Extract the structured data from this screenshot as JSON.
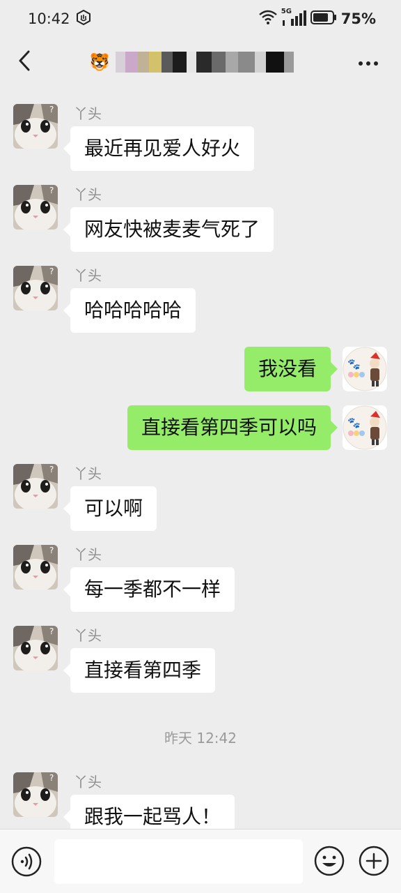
{
  "status_bar": {
    "time": "10:42",
    "network": "5G",
    "battery_percent": "75%"
  },
  "nav": {
    "title_emoji": "🐯"
  },
  "messages": [
    {
      "side": "left",
      "sender": "丫头",
      "text": "最近再见爱人好火"
    },
    {
      "side": "left",
      "sender": "丫头",
      "text": "网友快被麦麦气死了"
    },
    {
      "side": "left",
      "sender": "丫头",
      "text": "哈哈哈哈哈"
    },
    {
      "side": "right",
      "text": "我没看"
    },
    {
      "side": "right",
      "text": "直接看第四季可以吗"
    },
    {
      "side": "left",
      "sender": "丫头",
      "text": "可以啊"
    },
    {
      "side": "left",
      "sender": "丫头",
      "text": "每一季都不一样"
    },
    {
      "side": "left",
      "sender": "丫头",
      "text": "直接看第四季"
    },
    {
      "side": "left",
      "sender": "丫头",
      "text": "跟我一起骂人！"
    }
  ],
  "time_separator": "昨天 12:42",
  "input": {
    "value": "",
    "placeholder": ""
  },
  "colors": {
    "background": "#ededed",
    "incoming_bubble": "#ffffff",
    "outgoing_bubble": "#95ec69",
    "muted_text": "#8e8e8e"
  },
  "icons": {
    "back": "chevron-left-icon",
    "more": "more-dots-icon",
    "voice": "voice-icon",
    "emoji": "emoji-icon",
    "plus": "plus-icon"
  }
}
